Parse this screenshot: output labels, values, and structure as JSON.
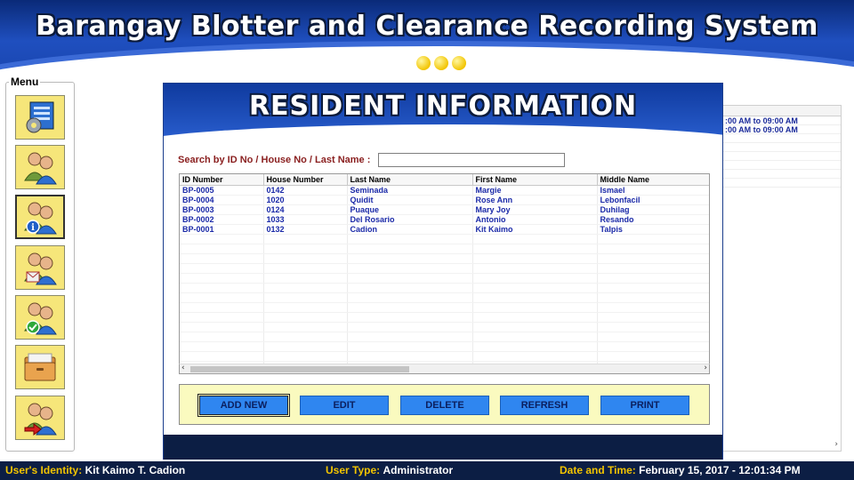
{
  "header": {
    "title": "Barangay Blotter and Clearance Recording System",
    "accent_color": "#1f4fbf",
    "dots_color": "#f2c400"
  },
  "menu": {
    "legend": "Menu",
    "items": [
      {
        "icon": "settings-dashboard-icon"
      },
      {
        "icon": "users-group-icon"
      },
      {
        "icon": "resident-info-icon"
      },
      {
        "icon": "blotter-report-icon"
      },
      {
        "icon": "clearance-approved-icon"
      },
      {
        "icon": "folder-records-icon"
      },
      {
        "icon": "logout-user-icon"
      }
    ]
  },
  "schedule_panel": {
    "rows": [
      ":00 AM  to  09:00 AM",
      ":00 AM  to  09:00 AM"
    ]
  },
  "resident_window": {
    "title": "RESIDENT INFORMATION",
    "search": {
      "label": "Search by ID No / House No / Last Name :",
      "value": "",
      "placeholder": ""
    },
    "table": {
      "columns": [
        "ID Number",
        "House Number",
        "Last Name",
        "First Name",
        "Middle Name"
      ],
      "rows": [
        [
          "BP-0005",
          "0142",
          "Seminada",
          "Margie",
          "Ismael"
        ],
        [
          "BP-0004",
          "1020",
          "Quidit",
          "Rose Ann",
          "Lebonfacil"
        ],
        [
          "BP-0003",
          "0124",
          "Puaque",
          "Mary Joy",
          "Duhilag"
        ],
        [
          "BP-0002",
          "1033",
          "Del Rosario",
          "Antonio",
          "Resando"
        ],
        [
          "BP-0001",
          "0132",
          "Cadion",
          "Kit Kaimo",
          "Talpis"
        ]
      ]
    },
    "buttons": {
      "add_new": "ADD NEW",
      "edit": "EDIT",
      "delete": "DELETE",
      "refresh": "REFRESH",
      "print": "PRINT"
    }
  },
  "status_bar": {
    "identity_label": "User's Identity:",
    "identity_value": "Kit Kaimo T. Cadion",
    "type_label": "User Type:",
    "type_value": "Administrator",
    "datetime_label": "Date and Time:",
    "datetime_value": "February 15, 2017  -  12:01:34 PM"
  }
}
